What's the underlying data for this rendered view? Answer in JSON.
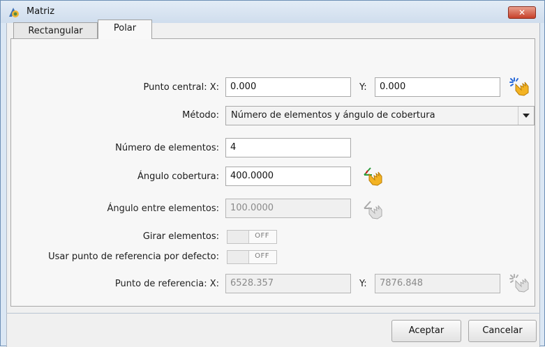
{
  "window": {
    "title": "Matriz"
  },
  "tabs": [
    {
      "label": "Rectangular",
      "active": false
    },
    {
      "label": "Polar",
      "active": true
    }
  ],
  "form": {
    "punto_central": {
      "label_x": "Punto central: X:",
      "x": "0.000",
      "label_y": "Y:",
      "y": "0.000"
    },
    "metodo": {
      "label": "Método:",
      "selected": "Número de elementos y ángulo de cobertura"
    },
    "numero_elementos": {
      "label": "Número de elementos:",
      "value": "4"
    },
    "angulo_cobertura": {
      "label": "Ángulo cobertura:",
      "value": "400.0000"
    },
    "angulo_entre": {
      "label": "Ángulo entre elementos:",
      "value": "100.0000",
      "enabled": false
    },
    "girar": {
      "label": "Girar elementos:",
      "state": "OFF"
    },
    "usar_ref": {
      "label": "Usar punto de referencia por defecto:",
      "state": "OFF"
    },
    "punto_ref": {
      "label_x": "Punto de referencia: X:",
      "x": "6528.357",
      "label_y": "Y:",
      "y": "7876.848",
      "enabled": false
    }
  },
  "buttons": {
    "accept": "Aceptar",
    "cancel": "Cancelar"
  },
  "icons": {
    "app": "matriz-app-icon",
    "pick": "hand-pick-point-icon",
    "close": "close-icon"
  },
  "colors": {
    "titlebar": "#dbe7f4",
    "close": "#c7402a",
    "panel": "#f7f7f7"
  }
}
